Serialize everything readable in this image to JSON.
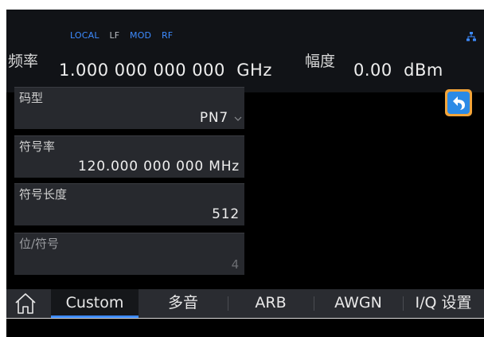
{
  "status": {
    "flags": [
      "LOCAL",
      "LF",
      "MOD",
      "RF"
    ],
    "network_icon": "network-icon"
  },
  "frequency": {
    "label": "频率",
    "value": "1.000 000 000 000",
    "unit": "GHz"
  },
  "amplitude": {
    "label": "幅度",
    "value": "0.00",
    "unit": "dBm"
  },
  "params": [
    {
      "label": "码型",
      "value": "PN7"
    },
    {
      "label": "符号率",
      "value": "120.000 000 000 MHz"
    },
    {
      "label": "符号长度",
      "value": "512"
    },
    {
      "label": "位/符号",
      "value": "4"
    }
  ],
  "back_button": {
    "icon": "back-arrow-icon"
  },
  "tabs": [
    {
      "label": "Custom",
      "active": true
    },
    {
      "label": "多音"
    },
    {
      "label": "ARB"
    },
    {
      "label": "AWGN"
    },
    {
      "label": "I/Q 设置"
    }
  ],
  "colors": {
    "accent": "#3d8bff",
    "back_button_border": "#f2a43a",
    "back_button_fill": "#2b8ae6"
  }
}
